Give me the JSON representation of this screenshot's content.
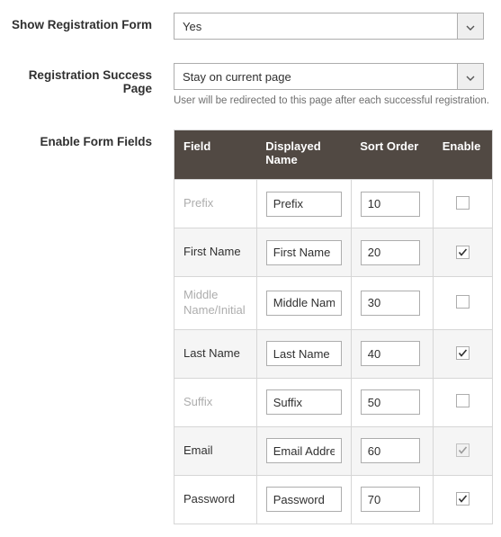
{
  "labels": {
    "show_registration_form": "Show Registration Form",
    "registration_success_page": "Registration Success Page",
    "enable_form_fields": "Enable Form Fields"
  },
  "show_registration_form": {
    "value": "Yes"
  },
  "registration_success_page": {
    "value": "Stay on current page",
    "note": "User will be redirected to this page after each successful registration."
  },
  "table": {
    "columns": {
      "field": "Field",
      "displayed_name": "Displayed Name",
      "sort_order": "Sort Order",
      "enable": "Enable"
    },
    "rows": [
      {
        "field": "Prefix",
        "muted": true,
        "displayed_name": "Prefix",
        "sort_order": "10",
        "enabled": false,
        "disabled": false
      },
      {
        "field": "First Name",
        "muted": false,
        "displayed_name": "First Name",
        "sort_order": "20",
        "enabled": true,
        "disabled": false
      },
      {
        "field": "Middle Name/Initial",
        "muted": true,
        "displayed_name": "Middle Nam",
        "sort_order": "30",
        "enabled": false,
        "disabled": false
      },
      {
        "field": "Last Name",
        "muted": false,
        "displayed_name": "Last Name",
        "sort_order": "40",
        "enabled": true,
        "disabled": false
      },
      {
        "field": "Suffix",
        "muted": true,
        "displayed_name": "Suffix",
        "sort_order": "50",
        "enabled": false,
        "disabled": false
      },
      {
        "field": "Email",
        "muted": false,
        "displayed_name": "Email Addre",
        "sort_order": "60",
        "enabled": true,
        "disabled": true
      },
      {
        "field": "Password",
        "muted": false,
        "displayed_name": "Password",
        "sort_order": "70",
        "enabled": true,
        "disabled": false
      }
    ]
  }
}
